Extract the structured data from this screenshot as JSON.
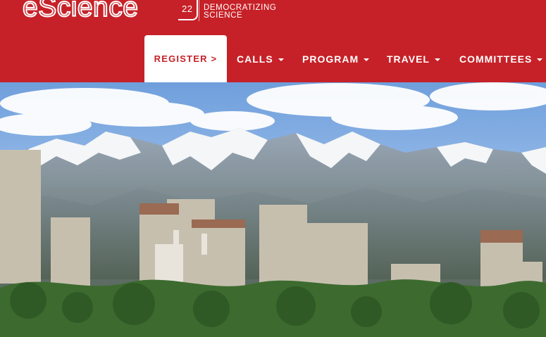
{
  "header": {
    "logo": {
      "wordmark": "eScience",
      "edition": "22",
      "tagline_line1": "DEMOCRATIZING",
      "tagline_line2": "SCIENCE"
    },
    "brand_color": "#c62128"
  },
  "nav": {
    "items": [
      {
        "label": "REGISTER >",
        "active": true
      },
      {
        "label": "CALLS",
        "has_dropdown": true
      },
      {
        "label": "PROGRAM",
        "has_dropdown": true
      },
      {
        "label": "TRAVEL",
        "has_dropdown": true
      },
      {
        "label": "COMMITTEES",
        "has_dropdown": true
      }
    ]
  },
  "hero": {
    "image": "city-skyline-with-snow-capped-mountains"
  }
}
